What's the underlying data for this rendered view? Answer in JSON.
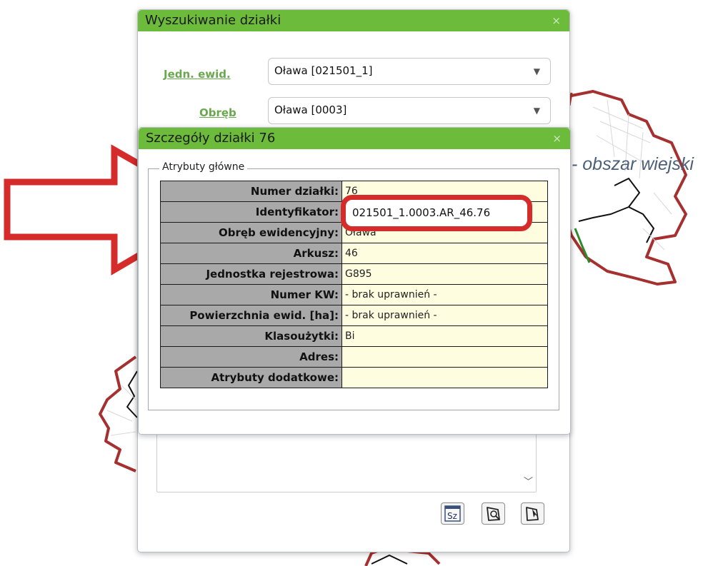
{
  "map": {
    "area_label": "- obszar wiejski"
  },
  "search_window": {
    "title": "Wyszukiwanie działki",
    "close_glyph": "×",
    "fields": [
      {
        "label": "Jedn. ewid.",
        "value": "Oława [021501_1]"
      },
      {
        "label": "Obręb",
        "value": "Oława [0003]"
      }
    ],
    "buttons": [
      {
        "name": "details-button",
        "label": "Sz"
      },
      {
        "name": "map-search-button",
        "label": ""
      },
      {
        "name": "map-select-button",
        "label": ""
      }
    ]
  },
  "details_window": {
    "title": "Szczegóły działki 76",
    "close_glyph": "×",
    "group_legend": "Atrybuty główne",
    "rows": [
      {
        "key": "Numer działki:",
        "value": "76"
      },
      {
        "key": "Identyfikator:",
        "value": "021501_1.0003.AR_46.76"
      },
      {
        "key": "Obręb ewidencyjny:",
        "value": "Oława"
      },
      {
        "key": "Arkusz:",
        "value": "46"
      },
      {
        "key": "Jednostka rejestrowa:",
        "value": "G895"
      },
      {
        "key": "Numer KW:",
        "value": "- brak uprawnień -"
      },
      {
        "key": "Powierzchnia ewid. [ha]:",
        "value": "- brak uprawnień -"
      },
      {
        "key": "Klasoużytki:",
        "value": "Bi"
      },
      {
        "key": "Adres:",
        "value": ""
      },
      {
        "key": "Atrybuty dodatkowe:",
        "value": ""
      }
    ]
  },
  "annotation": {
    "highlight_color": "#d62b2b"
  }
}
